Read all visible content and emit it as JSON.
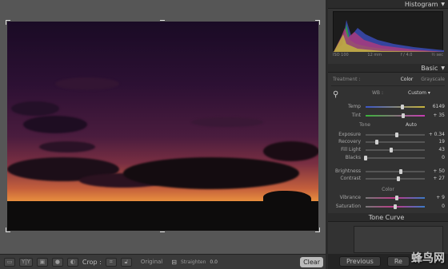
{
  "panel": {
    "histogram_title": "Histogram",
    "histogram_readout": {
      "iso": "ISO 100",
      "focal": "12 mm",
      "aperture": "f / 4.0",
      "shutter": "½ sec"
    },
    "basic_title": "Basic",
    "treatment_label": "Treatment :",
    "treatment_color": "Color",
    "treatment_gray": "Grayscale",
    "wb_label": "WB :",
    "wb_value": "Custom",
    "tone_label": "Tone",
    "auto_label": "Auto",
    "presence_label": "Color",
    "tone_curve_title": "Tone Curve",
    "sliders": [
      {
        "label": "Temp",
        "value": "6149",
        "level": 0.62
      },
      {
        "label": "Tint",
        "value": "+ 35",
        "level": 0.64
      },
      {
        "label": "Exposure",
        "value": "+ 0.34",
        "level": 0.53
      },
      {
        "label": "Recovery",
        "value": "19",
        "level": 0.19
      },
      {
        "label": "Fill Light",
        "value": "43",
        "level": 0.43
      },
      {
        "label": "Blacks",
        "value": "0",
        "level": 0.0
      },
      {
        "label": "Brightness",
        "value": "+ 50",
        "level": 0.6
      },
      {
        "label": "Contrast",
        "value": "+ 27",
        "level": 0.55
      },
      {
        "label": "Vibrance",
        "value": "+ 9",
        "level": 0.53
      },
      {
        "label": "Saturation",
        "value": "0",
        "level": 0.5
      }
    ]
  },
  "toolbar": {
    "crop_label": "Crop :",
    "aspect_value": "Original",
    "straighten_label": "Straighten",
    "straighten_value": "0.0",
    "clear_label": "Clear"
  },
  "bottom": {
    "previous_label": "Previous",
    "reset_label": "Re"
  },
  "watermark": "蜂鸟网"
}
